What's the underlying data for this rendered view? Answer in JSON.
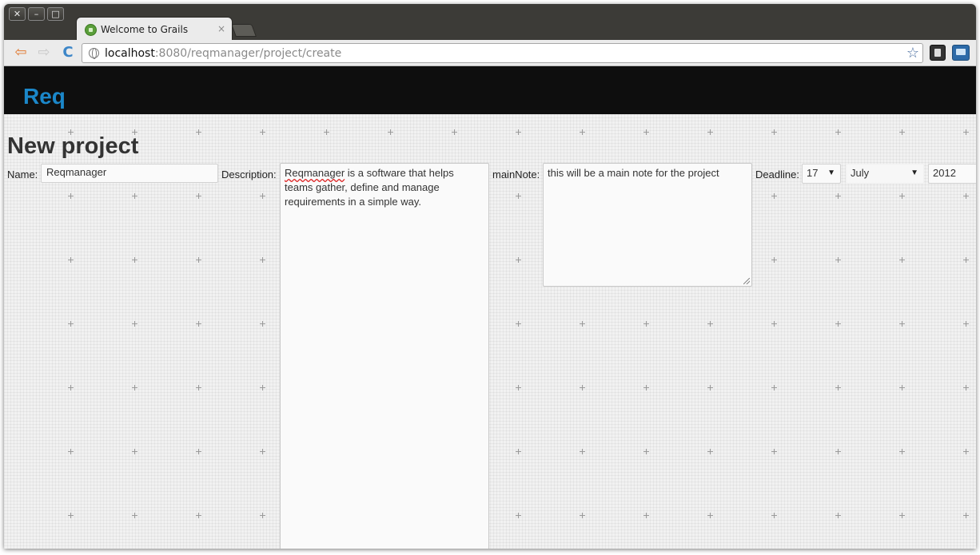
{
  "window": {
    "controls": [
      "✕",
      "–",
      "□"
    ]
  },
  "tab": {
    "title": "Welcome to Grails",
    "close": "×"
  },
  "toolbar": {
    "back": "⇦",
    "forward": "⇨",
    "reload": "C",
    "url_host": "localhost",
    "url_rest": ":8080/reqmanager/project/create",
    "bookmark": "☆"
  },
  "navbar": {
    "brand": "Req"
  },
  "form": {
    "title": "New project",
    "name_label": "Name:",
    "name_value": "Reqmanager",
    "description_label": "Description:",
    "description_word": "Reqmanager",
    "description_rest": " is a software that helps teams gather, define and manage requirements in a simple way.",
    "mainnote_label": "mainNote:",
    "mainnote_value": "this will be a main note for the project",
    "deadline_label": "Deadline:",
    "deadline_day": "17",
    "deadline_month": "July",
    "deadline_year": "2012",
    "caret": "▼"
  },
  "colors": {
    "brand": "#1b87c9",
    "navbar_bg": "#0e0e0e",
    "page_bg": "#f1f1f1"
  }
}
